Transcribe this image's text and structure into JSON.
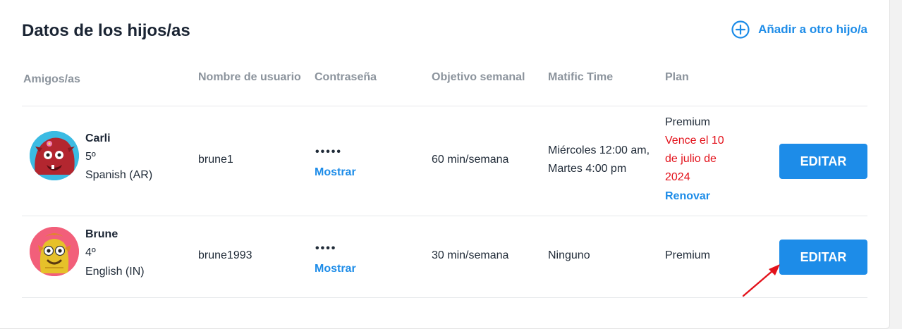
{
  "header": {
    "title": "Datos de los hijos/as",
    "add_child_label": "Añadir a otro hijo/a"
  },
  "table": {
    "columns": {
      "friends": "Amigos/as",
      "username": "Nombre de usuario",
      "password": "Contraseña",
      "weekly_goal": "Objetivo semanal",
      "matific_time": "Matific Time",
      "plan": "Plan"
    },
    "rows": [
      {
        "name": "Carli",
        "grade": "5º",
        "language": "Spanish (AR)",
        "username": "brune1",
        "password_mask": "•••••",
        "show_label": "Mostrar",
        "weekly_goal": "60 min/semana",
        "matific_time_line1": "Miércoles 12:00 am,",
        "matific_time_line2": "Martes 4:00 pm",
        "plan": "Premium",
        "expiry_line1": "Vence el 10",
        "expiry_line2": "de julio de",
        "expiry_line3": "2024",
        "renew_label": "Renovar",
        "edit_label": "EDITAR"
      },
      {
        "name": "Brune",
        "grade": "4º",
        "language": "English (IN)",
        "username": "brune1993",
        "password_mask": "••••",
        "show_label": "Mostrar",
        "weekly_goal": "30 min/semana",
        "matific_time": "Ninguno",
        "plan": "Premium",
        "edit_label": "EDITAR"
      }
    ]
  },
  "colors": {
    "accent": "#1d8ce8",
    "expiry": "#e3121b",
    "annotation_arrow": "#e3121b"
  }
}
